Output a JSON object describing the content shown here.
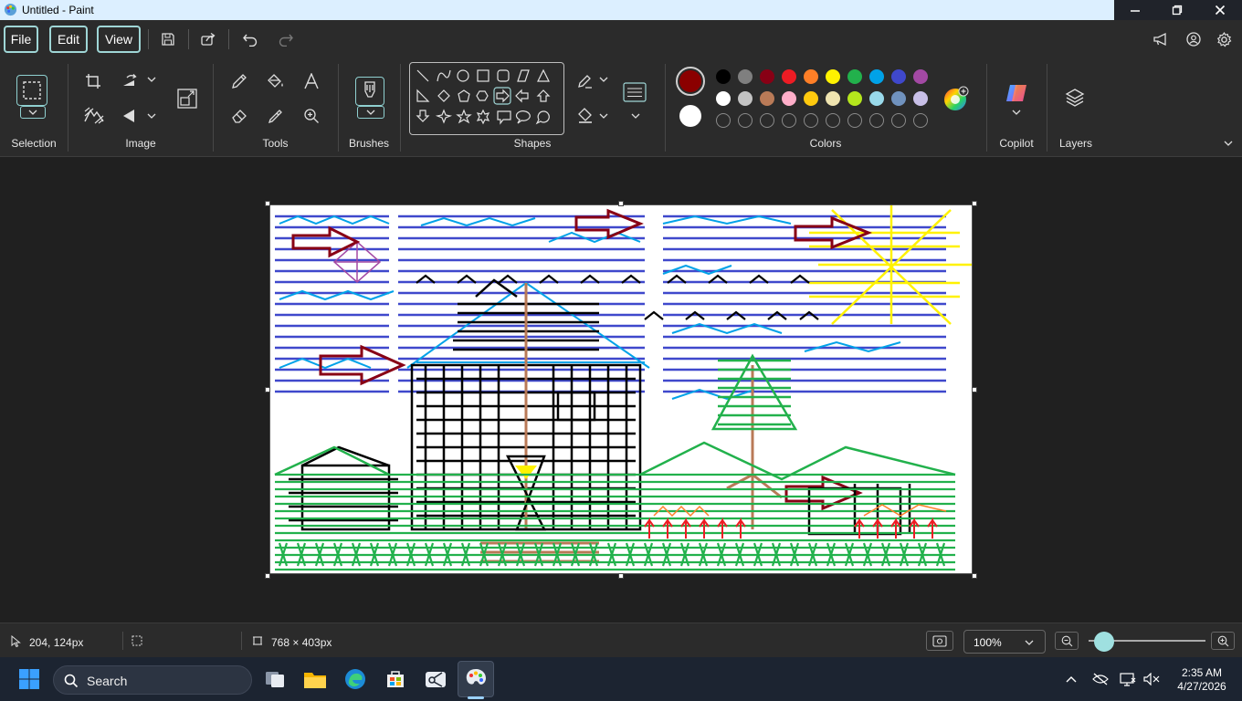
{
  "window": {
    "title": "Untitled - Paint"
  },
  "menu": {
    "file": "File",
    "edit": "Edit",
    "view": "View"
  },
  "ribbon": {
    "groups": {
      "selection": "Selection",
      "image": "Image",
      "tools": "Tools",
      "brushes": "Brushes",
      "shapes": "Shapes",
      "colors": "Colors",
      "copilot": "Copilot",
      "layers": "Layers"
    },
    "primary_color": "#8b0000",
    "secondary_color": "#ffffff",
    "palette_row1": [
      "#000000",
      "#7f7f7f",
      "#880015",
      "#ed1c24",
      "#ff7f27",
      "#fff200",
      "#22b14c",
      "#00a2e8",
      "#3f48cc",
      "#a349a4"
    ],
    "palette_row2": [
      "#ffffff",
      "#c3c3c3",
      "#b97a57",
      "#ffaec9",
      "#ffc90e",
      "#efe4b0",
      "#b5e61d",
      "#99d9ea",
      "#7092be",
      "#c8bfe7"
    ]
  },
  "status": {
    "cursor_pos": "204, 124px",
    "canvas_size": "768 × 403px",
    "zoom": "100%",
    "zoom_level": 0.1
  },
  "taskbar": {
    "search": "Search",
    "time": "2:35 AM",
    "date": "4/27/2026"
  }
}
